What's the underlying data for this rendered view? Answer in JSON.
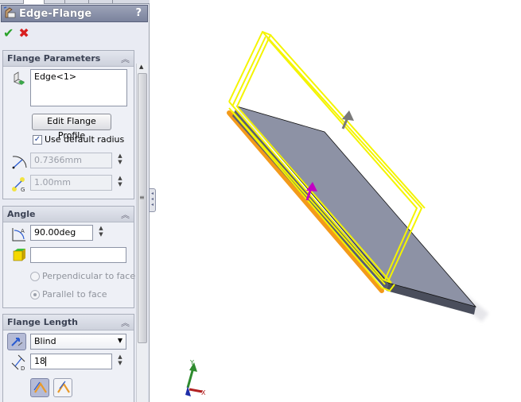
{
  "property_manager": {
    "title": "Edge-Flange",
    "help_label": "?",
    "ok_icon": "green-check-icon",
    "cancel_icon": "red-x-icon",
    "ok_glyph": "✔",
    "cancel_glyph": "✖",
    "groups": {
      "flange_parameters": {
        "title": "Flange Parameters",
        "collapse_glyph": "︽",
        "edge_selection": "Edge<1>",
        "edit_profile_button": "Edit Flange Profile",
        "use_default_radius_label": "Use default radius",
        "use_default_radius_checked": true,
        "check_glyph": "✓",
        "bend_radius": "0.7366mm",
        "gap_distance": "1.00mm",
        "spin_glyph": "▲\n▼"
      },
      "angle": {
        "title": "Angle",
        "collapse_glyph": "︽",
        "flange_angle": "90.00deg",
        "face_selection": "",
        "perpendicular_label": "Perpendicular to face",
        "parallel_label": "Parallel to face",
        "selected_option": "Parallel to face"
      },
      "flange_length": {
        "title": "Flange Length",
        "collapse_glyph": "︽",
        "end_condition": "Blind",
        "dropdown_glyph": "▼",
        "length_value": "18"
      }
    }
  },
  "viewport": {
    "triad_labels": {
      "x": "X",
      "y": "Y"
    },
    "colors": {
      "sheet_top": "#8d92a5",
      "sheet_side": "#4a4e5c",
      "preview": "#f4f400",
      "selected_edge": "#f39a1a",
      "drag_handle": "#c200c2",
      "direction_arrow": "#7a7a7a"
    }
  }
}
